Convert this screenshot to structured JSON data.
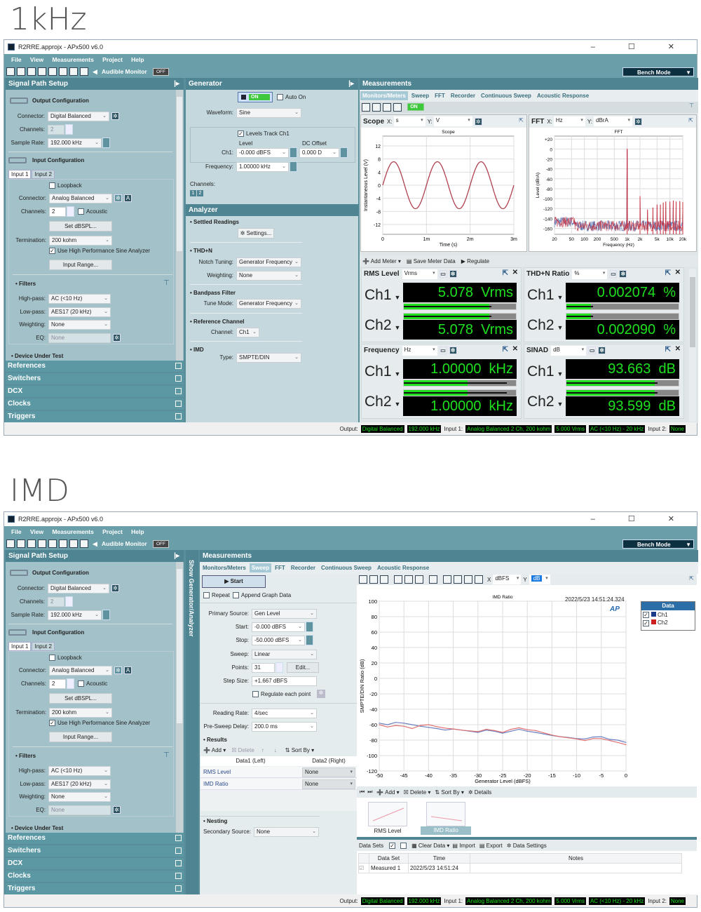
{
  "labels": {
    "top": "1kHz",
    "bottom": "IMD"
  },
  "app": {
    "title": "R2RRE.approjx - APx500 v6.0",
    "window_buttons": "– ☐ ✕",
    "menu": [
      "File",
      "View",
      "Measurements",
      "Project",
      "Help"
    ],
    "audible_monitor": "Audible Monitor",
    "audible_state": "OFF",
    "bench_mode": "Bench Mode"
  },
  "signal_path": {
    "title": "Signal Path Setup",
    "output_config": "Output Configuration",
    "connector_label": "Connector:",
    "out_connector": "Digital Balanced",
    "channels_label": "Channels:",
    "out_channels": "2",
    "sample_rate_label": "Sample Rate:",
    "sample_rate": "192.000 kHz",
    "input_config": "Input Configuration",
    "tabs": [
      "Input 1",
      "Input 2"
    ],
    "loopback": "Loopback",
    "in_connector": "Analog Balanced",
    "in_channels": "2",
    "acoustic": "Acoustic",
    "set_dbspl": "Set dBSPL...",
    "termination_label": "Termination:",
    "termination": "200 kohm",
    "use_hp": "Use High Performance Sine Analyzer",
    "input_range": "Input Range...",
    "filters": "• Filters",
    "highpass_label": "High-pass:",
    "highpass": "AC (<10 Hz)",
    "lowpass_label": "Low-pass:",
    "lowpass": "AES17 (20 kHz)",
    "weighting_label": "Weighting:",
    "weighting": "None",
    "eq_label": "EQ:",
    "eq": "None",
    "dut": "• Device Under Test",
    "sections": [
      "References",
      "Switchers",
      "DCX",
      "Clocks",
      "Triggers"
    ]
  },
  "generator": {
    "title": "Generator",
    "on": "ON",
    "auto_on": "Auto On",
    "waveform_label": "Waveform:",
    "waveform": "Sine",
    "levels_track": "Levels Track Ch1",
    "level_label": "Level",
    "dc_label": "DC Offset",
    "ch1_label": "Ch1:",
    "level": "-0.000 dBFS",
    "dc": "0.000 D",
    "freq_label": "Frequency:",
    "freq": "1.00000 kHz",
    "channels_label": "Channels:",
    "ch_buttons": [
      "1",
      "2"
    ]
  },
  "analyzer": {
    "title": "Analyzer",
    "settled": "• Settled Readings",
    "settings": "Settings...",
    "thdn": "• THD+N",
    "notch_label": "Notch Tuning:",
    "notch": "Generator Frequency",
    "weighting_label": "Weighting:",
    "weighting": "None",
    "bandpass": "• Bandpass Filter",
    "tune_label": "Tune Mode:",
    "tune": "Generator Frequency",
    "refch": "• Reference Channel",
    "channel_label": "Channel:",
    "channel": "Ch1",
    "imd": "• IMD",
    "type_label": "Type:",
    "type": "SMPTE/DIN"
  },
  "measurements": {
    "title": "Measurements",
    "tabs": [
      "Monitors/Meters",
      "Sweep",
      "FFT",
      "Recorder",
      "Continuous Sweep",
      "Acoustic Response"
    ],
    "on": "ON",
    "show_gen": "Show Generator/Analyzer"
  },
  "scope": {
    "name": "Scope",
    "x_label": "X:",
    "x_unit": "s",
    "y_label": "Y:",
    "y_unit": "V"
  },
  "fft": {
    "name": "FFT",
    "x_label": "X:",
    "x_unit": "Hz",
    "y_label": "Y:",
    "y_unit": "dBrA"
  },
  "meter_toolbar": {
    "add": "Add Meter",
    "save": "Save Meter Data",
    "regulate": "Regulate"
  },
  "meters": [
    {
      "name": "RMS Level",
      "unit": "Vrms",
      "ch": [
        {
          "label": "Ch1",
          "value": "5.078  Vrms",
          "fill": 0.76
        },
        {
          "label": "Ch2",
          "value": "5.078  Vrms",
          "fill": 0.76
        }
      ]
    },
    {
      "name": "THD+N Ratio",
      "unit": "%",
      "ch": [
        {
          "label": "Ch1",
          "value": "0.002074  %",
          "fill": 0.22
        },
        {
          "label": "Ch2",
          "value": "0.002090  %",
          "fill": 0.22
        }
      ]
    },
    {
      "name": "Frequency",
      "unit": "Hz",
      "ch": [
        {
          "label": "Ch1",
          "value": "1.00000  kHz",
          "fill": 0.57
        },
        {
          "label": "Ch2",
          "value": "1.00000  kHz",
          "fill": 0.57
        }
      ]
    },
    {
      "name": "SINAD",
      "unit": "dB",
      "ch": [
        {
          "label": "Ch1",
          "value": "93.663  dB",
          "fill": 0.79
        },
        {
          "label": "Ch2",
          "value": "93.599  dB",
          "fill": 0.79
        }
      ]
    }
  ],
  "status": {
    "output_label": "Output:",
    "output": [
      "Digital Balanced",
      "192.000 kHz"
    ],
    "input1_label": "Input 1:",
    "input1": [
      "Analog Balanced 2 Ch, 200 kohm",
      "5.000 Vrms",
      "AC (<10 Hz) - 20 kHz"
    ],
    "input2_label": "Input 2:",
    "input2": "None"
  },
  "sweep": {
    "start_btn": "Start",
    "repeat": "Repeat",
    "append": "Append Graph Data",
    "primary_label": "Primary Source:",
    "primary": "Gen Level",
    "start_label": "Start:",
    "start": "-0.000 dBFS",
    "stop_label": "Stop:",
    "stop": "-50.000 dBFS",
    "sweep_label": "Sweep:",
    "sweep": "Linear",
    "points_label": "Points:",
    "points": "31",
    "edit": "Edit...",
    "step_label": "Step Size:",
    "step": "+1.667 dBFS",
    "regulate": "Regulate each point",
    "rate_label": "Reading Rate:",
    "rate": "4/sec",
    "delay_label": "Pre-Sweep Delay:",
    "delay": "200.0 ms",
    "results": "• Results",
    "add": "Add",
    "delete": "Delete",
    "sort": "Sort By",
    "col1": "Data1 (Left)",
    "col2": "Data2 (Right)",
    "rows": [
      {
        "name": "RMS Level",
        "data2": "None"
      },
      {
        "name": "IMD Ratio",
        "data2": "None"
      }
    ],
    "nesting": "• Nesting",
    "secondary_label": "Secondary Source:",
    "secondary": "None"
  },
  "graph": {
    "x_label": "X",
    "x_unit": "dBFS",
    "y_label": "Y",
    "y_unit": "dB",
    "timestamp": "2022/5/23 14:51:24.324",
    "legend_title": "Data",
    "legend": [
      {
        "name": "Ch1",
        "color": "#1a3a8a"
      },
      {
        "name": "Ch2",
        "color": "#cc2020"
      }
    ],
    "thumb_toolbar": {
      "add": "Add",
      "delete": "Delete",
      "sort": "Sort By",
      "details": "Details"
    },
    "thumbs": [
      "RMS Level",
      "IMD Ratio"
    ]
  },
  "datasets": {
    "label": "Data Sets",
    "clear": "Clear Data",
    "import": "Import",
    "export": "Export",
    "settings": "Data Settings",
    "cols": [
      "Data Set",
      "Time",
      "Notes"
    ],
    "rows": [
      {
        "name": "Measured 1",
        "time": "2022/5/23 14:51:24",
        "notes": ""
      }
    ]
  },
  "chart_data": [
    {
      "type": "line",
      "title": "Scope",
      "xlabel": "Time (s)",
      "ylabel": "Instantaneous Level (V)",
      "xlim": [
        0,
        0.003
      ],
      "ylim": [
        -15,
        15
      ],
      "xticks": [
        "0",
        "1m",
        "2m",
        "3m"
      ],
      "yticks": [
        "12",
        "8",
        "4",
        "0",
        "-4",
        "-8",
        "-12"
      ],
      "ytick_values": [
        12,
        8,
        4,
        0,
        -4,
        -8,
        -12
      ],
      "grid": true,
      "signal": {
        "waveform": "sine",
        "frequency_hz": 1000,
        "amplitude_v": 7.18
      },
      "colors": [
        "#b04050"
      ]
    },
    {
      "type": "line",
      "title": "FFT",
      "xlabel": "Frequency (Hz)",
      "ylabel": "Level (dBrA)",
      "xscale": "log",
      "xlim": [
        20,
        20000
      ],
      "ylim": [
        -172,
        26
      ],
      "xticks": [
        "20",
        "50",
        "100",
        "200",
        "500",
        "1k",
        "2k",
        "5k",
        "10k",
        "20k"
      ],
      "xtick_values": [
        20,
        50,
        100,
        200,
        500,
        1000,
        2000,
        5000,
        10000,
        20000
      ],
      "yticks": [
        "+20",
        "0",
        "-20",
        "-40",
        "-60",
        "-80",
        "-100",
        "-120",
        "-140",
        "-160"
      ],
      "ytick_values": [
        20,
        0,
        -20,
        -40,
        -60,
        -80,
        -100,
        -120,
        -140,
        -160
      ],
      "grid": true,
      "peaks": [
        {
          "f": 1000,
          "db": 0
        },
        {
          "f": 2000,
          "db": -95
        },
        {
          "f": 3000,
          "db": -122
        },
        {
          "f": 4000,
          "db": -118
        },
        {
          "f": 5000,
          "db": -112
        },
        {
          "f": 6000,
          "db": -112
        },
        {
          "f": 7000,
          "db": -108
        },
        {
          "f": 8000,
          "db": -106
        },
        {
          "f": 10000,
          "db": -106
        },
        {
          "f": 12000,
          "db": -104
        },
        {
          "f": 14000,
          "db": -106
        },
        {
          "f": 17000,
          "db": -105
        },
        {
          "f": 20000,
          "db": -107
        }
      ],
      "noise_floor_db": -152,
      "series": [
        {
          "name": "Ch1",
          "color": "#4060a8"
        },
        {
          "name": "Ch2",
          "color": "#c83040"
        }
      ]
    },
    {
      "type": "line",
      "title": "IMD Ratio",
      "xlabel": "Generator Level (dBFS)",
      "ylabel": "SMPTE/DIN Ratio (dB)",
      "xlim": [
        -50,
        0
      ],
      "ylim": [
        -120,
        100
      ],
      "xticks": [
        "-50",
        "-45",
        "-40",
        "-35",
        "-30",
        "-25",
        "-20",
        "-15",
        "-10",
        "-5",
        "0"
      ],
      "xtick_values": [
        -50,
        -45,
        -40,
        -35,
        -30,
        -25,
        -20,
        -15,
        -10,
        -5,
        0
      ],
      "yticks": [
        "100",
        "80",
        "60",
        "40",
        "20",
        "0",
        "-20",
        "-40",
        "-60",
        "-80",
        "-100",
        "-120"
      ],
      "ytick_values": [
        100,
        80,
        60,
        40,
        20,
        0,
        -20,
        -40,
        -60,
        -80,
        -100,
        -120
      ],
      "grid": true,
      "legend": "right",
      "x": [
        -50,
        -48.33,
        -46.67,
        -45,
        -43.33,
        -41.67,
        -40,
        -38.33,
        -36.67,
        -35,
        -33.33,
        -31.67,
        -30,
        -28.33,
        -26.67,
        -25,
        -23.33,
        -21.67,
        -20,
        -18.33,
        -16.67,
        -15,
        -13.33,
        -11.67,
        -10,
        -8.33,
        -6.67,
        -5,
        -3.33,
        -1.67,
        0
      ],
      "series": [
        {
          "name": "Ch1",
          "color": "#6a7fc0",
          "values": [
            -58,
            -60,
            -57,
            -58,
            -60,
            -62,
            -63.5,
            -65,
            -67,
            -65.5,
            -67,
            -68.5,
            -70,
            -67,
            -68.5,
            -71,
            -68.5,
            -66,
            -68.5,
            -70,
            -72,
            -74,
            -75.5,
            -76.5,
            -78,
            -78.5,
            -76,
            -75.5,
            -79,
            -80,
            -83
          ]
        },
        {
          "name": "Ch2",
          "color": "#e07070",
          "values": [
            -60,
            -63,
            -61,
            -62,
            -65,
            -61,
            -60,
            -62.5,
            -64.5,
            -65.5,
            -67,
            -68,
            -69,
            -66,
            -67.5,
            -70,
            -66,
            -64,
            -66.5,
            -67.5,
            -70.5,
            -73.5,
            -75.5,
            -77,
            -78.5,
            -80.5,
            -78,
            -78,
            -80.5,
            -83,
            -86
          ]
        }
      ]
    }
  ]
}
